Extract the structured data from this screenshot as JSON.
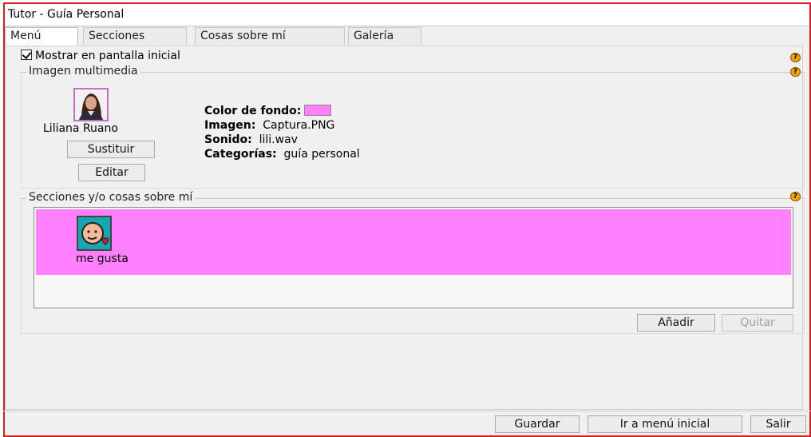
{
  "window": {
    "title": "Tutor - Guía Personal"
  },
  "tabs": [
    {
      "label": "Menú",
      "active": true
    },
    {
      "label": "Secciones",
      "active": false
    },
    {
      "label": "Cosas sobre mí",
      "active": false
    },
    {
      "label": "Galería",
      "active": false
    }
  ],
  "options": {
    "show_on_start_label": "Mostrar en pantalla inicial",
    "show_on_start_checked": true
  },
  "multimedia": {
    "group_title": "Imagen multimedia",
    "person_name": "Liliana Ruano",
    "replace_label": "Sustituir",
    "edit_label": "Editar",
    "background_color_key": "Color de fondo:",
    "background_color": "#ff80ff",
    "image_key": "Imagen:",
    "image_value": "Captura.PNG",
    "sound_key": "Sonido:",
    "sound_value": "lili.wav",
    "categories_key": "Categorías:",
    "categories_value": "guía personal"
  },
  "sections": {
    "group_title": "Secciones y/o cosas sobre mí",
    "items": [
      {
        "label": "me gusta",
        "icon": "face-heart-icon"
      }
    ],
    "strip_color": "#ff80ff",
    "add_label": "Añadir",
    "remove_label": "Quitar"
  },
  "footer": {
    "save_label": "Guardar",
    "home_label": "Ir a menú inicial",
    "exit_label": "Salir"
  },
  "help_icon_text": "?"
}
